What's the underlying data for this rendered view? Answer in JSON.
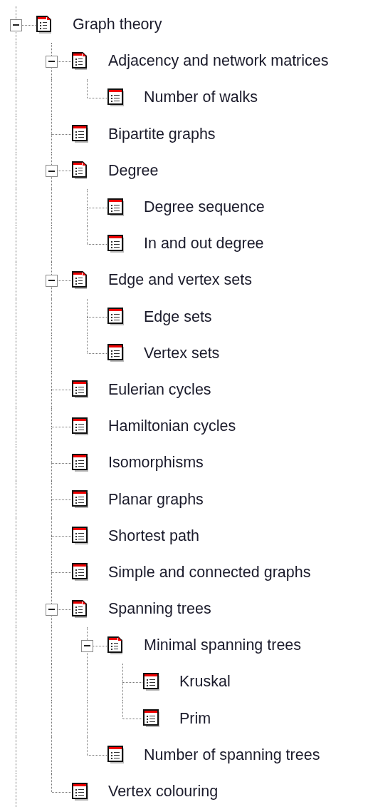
{
  "tree": [
    {
      "label": "Graph theory",
      "expanded": true,
      "children": [
        {
          "label": "Adjacency and network matrices",
          "expanded": true,
          "children": [
            {
              "label": "Number of walks"
            }
          ]
        },
        {
          "label": "Bipartite graphs"
        },
        {
          "label": "Degree",
          "expanded": true,
          "children": [
            {
              "label": "Degree sequence"
            },
            {
              "label": "In and out degree"
            }
          ]
        },
        {
          "label": "Edge and vertex sets",
          "expanded": true,
          "children": [
            {
              "label": "Edge sets"
            },
            {
              "label": "Vertex sets"
            }
          ]
        },
        {
          "label": "Eulerian cycles"
        },
        {
          "label": "Hamiltonian cycles"
        },
        {
          "label": "Isomorphisms"
        },
        {
          "label": "Planar graphs"
        },
        {
          "label": "Shortest path"
        },
        {
          "label": "Simple and connected graphs"
        },
        {
          "label": "Spanning trees",
          "expanded": true,
          "children": [
            {
              "label": "Minimal spanning trees",
              "expanded": true,
              "children": [
                {
                  "label": "Kruskal"
                },
                {
                  "label": "Prim"
                }
              ]
            },
            {
              "label": "Number of spanning trees"
            }
          ]
        },
        {
          "label": "Vertex colouring"
        }
      ]
    }
  ]
}
